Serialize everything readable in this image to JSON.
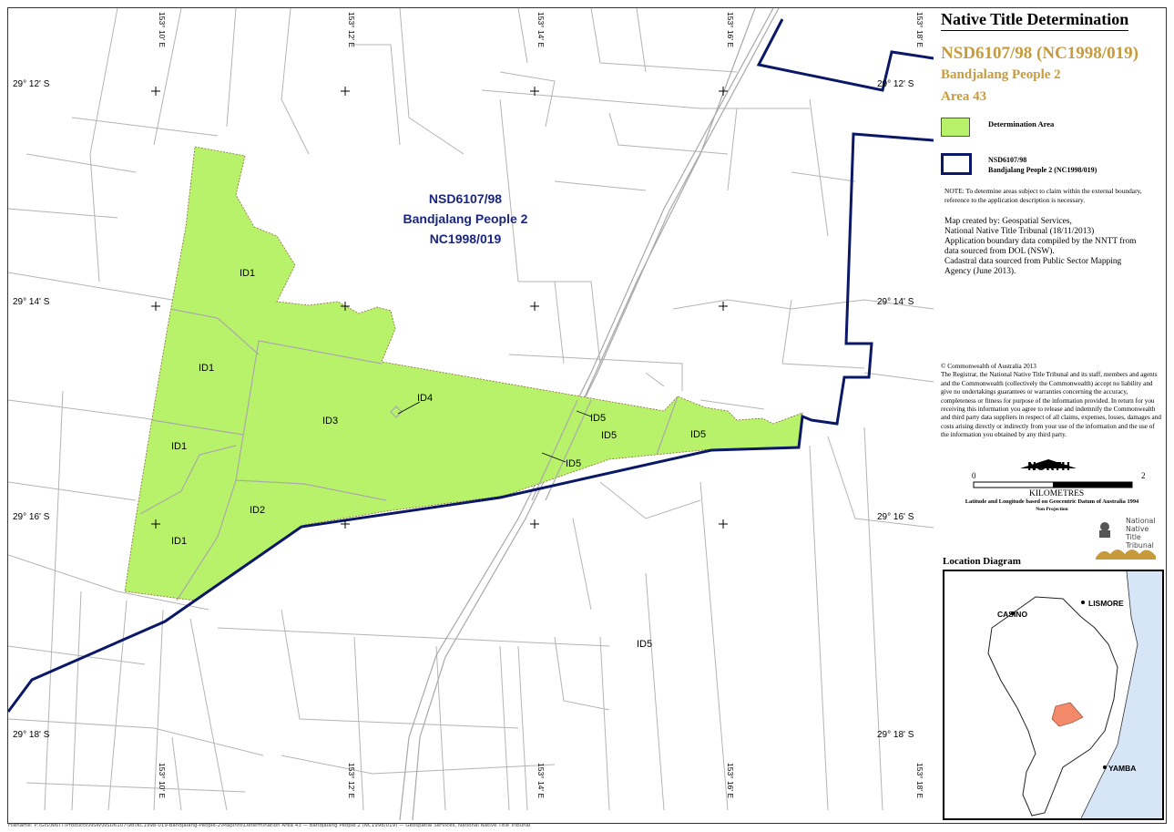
{
  "sidebar": {
    "title": "Native Title Determination",
    "case_number": "NSD6107/98 (NC1998/019)",
    "people": "Bandjalang People 2",
    "area": "Area 43",
    "legend": {
      "determination_area": "Determination Area",
      "boundary_line1": "NSD6107/98",
      "boundary_line2": "Bandjalang People 2 (NC1998/019)"
    },
    "note": "NOTE: To determine areas subject to claim within the external boundary, reference to the application description is necessary.",
    "credits": [
      "Map created by: Geospatial Services,",
      "National Native Title Tribunal   (18/11/2013)",
      "Application boundary data compiled by the NNTT from",
      "data sourced from DOL (NSW).",
      "Cadastral data sourced from Public Sector Mapping",
      "Agency (June 2013)."
    ],
    "copyright_title": "© Commonwealth of Australia 2013",
    "copyright_body": "The Registrar, the National Native Title Tribunal and its staff, members and agents and the Commonwealth (collectively the Commonwealth) accept no liability and give no undertakings guarantees or warranties concerning the accuracy, completeness or fitness for purpose of the information provided. In return for you receiving this information you agree to release and indemnify the Commonwealth and third party data suppliers in respect of all claims, expenses, losses, damages and costs arising directly or indirectly from your use of the information and the use of the information you obtained by any third party.",
    "north_label": "NORTH",
    "scale_start": "0",
    "scale_end": "2",
    "scale_unit": "KILOMETRES",
    "datum_note": "Latitude and Longitude based on Geocentric Datum of Australia 1994",
    "projection_note": "Non Projection",
    "logo_text": [
      "National",
      "Native Title",
      "Tribunal"
    ],
    "location_title": "Location Diagram",
    "towns": {
      "casino": "CASINO",
      "lismore": "LISMORE",
      "yamba": "YAMBA"
    }
  },
  "map": {
    "claim_label": [
      "NSD6107/98",
      "Bandjalang People 2",
      "NC1998/019"
    ],
    "lat_labels": [
      "29° 12' S",
      "29° 14' S",
      "29° 16' S",
      "29° 18' S"
    ],
    "lon_labels": [
      "153° 10' E",
      "153° 12' E",
      "153° 14' E",
      "153° 16' E",
      "153° 18' E"
    ],
    "parcels": [
      "ID1",
      "ID1",
      "ID1",
      "ID1",
      "ID2",
      "ID3",
      "ID4",
      "ID5",
      "ID5",
      "ID5",
      "ID5",
      "ID5"
    ],
    "colors": {
      "determination": "#B8F26B",
      "boundary": "#0B1867",
      "cadastre": "#B4B4B4",
      "claim_text": "#1A2680"
    }
  },
  "footnote": "Filename: P:\\GIS\\NNTT\\Products\\NSW\\NSD6107\\98\\NC1998-019-Bandjalang-People-2\\MapInfo\\Determination Area 43 — Bandjalang People 2 (NC1998/019) — Geospatial Services, National Native Title Tribunal"
}
